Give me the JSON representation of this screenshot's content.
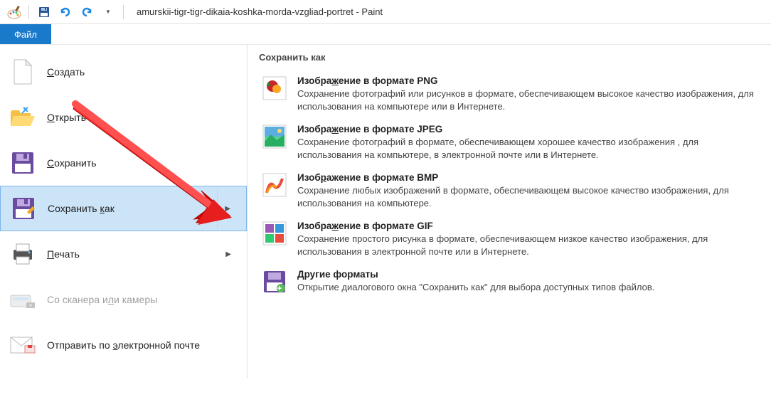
{
  "titlebar": {
    "title": "amurskii-tigr-tigr-dikaia-koshka-morda-vzgliad-portret - Paint"
  },
  "tabs": {
    "file": "Файл"
  },
  "menu": {
    "new": "Создать",
    "open": "Открыть",
    "save": "Сохранить",
    "save_as": "Сохранить как",
    "print": "Печать",
    "scanner": "Со сканера или камеры",
    "email": "Отправить по электронной почте"
  },
  "panel": {
    "title": "Сохранить как",
    "png_title": "Изображение в формате PNG",
    "png_desc": "Сохранение фотографий или рисунков в формате, обеспечивающем высокое качество изображения, для использования на компьютере или в Интернете.",
    "jpeg_title": "Изображение в формате JPEG",
    "jpeg_desc": "Сохранение фотографий в формате, обеспечивающем хорошее качество изображения , для использования на компьютере, в электронной почте или в Интернете.",
    "bmp_title": "Изображение в формате BMP",
    "bmp_desc": "Сохранение любых изображений в формате, обеспечивающем высокое качество изображения, для использования на компьютере.",
    "gif_title": "Изображение в формате GIF",
    "gif_desc": "Сохранение простого рисунка в формате, обеспечивающем низкое качество изображения, для использования в электронной почте или в Интернете.",
    "other_title": "Другие форматы",
    "other_desc": "Открытие диалогового окна \"Сохранить как\" для выбора доступных типов файлов."
  }
}
